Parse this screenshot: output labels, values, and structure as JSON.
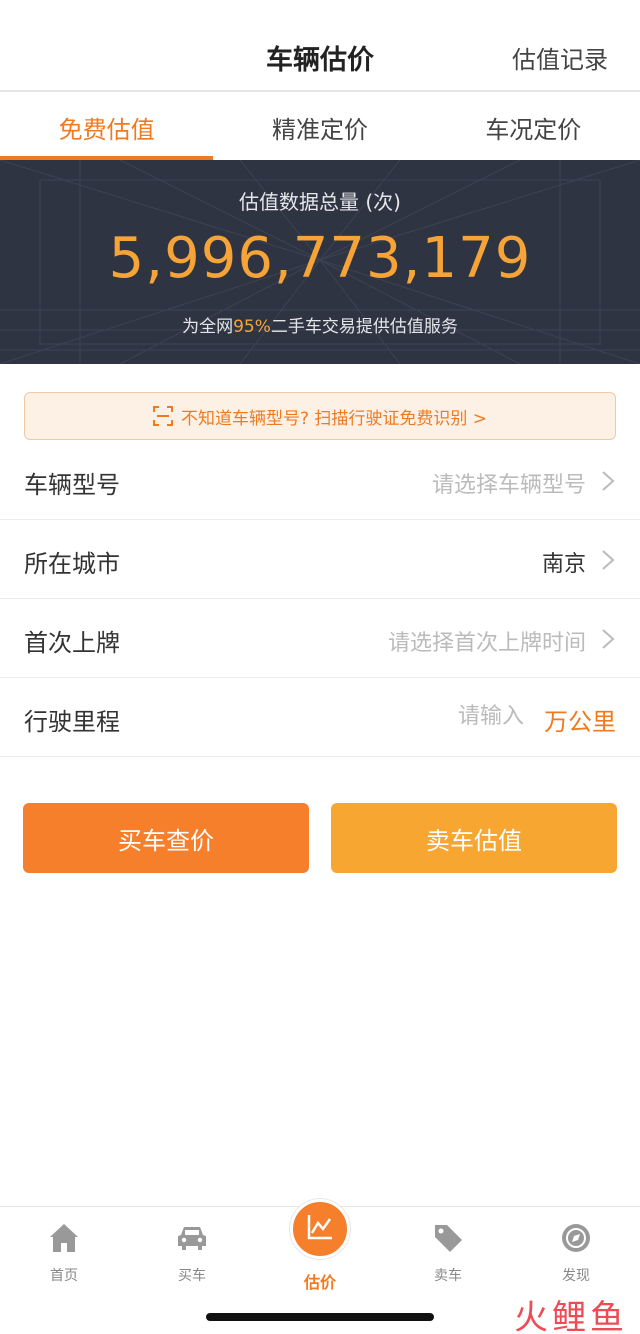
{
  "header": {
    "title": "车辆估价",
    "record_link": "估值记录"
  },
  "tabs": [
    {
      "label": "免费估值",
      "active": true
    },
    {
      "label": "精准定价",
      "active": false
    },
    {
      "label": "车况定价",
      "active": false
    }
  ],
  "banner": {
    "label": "估值数据总量 (次)",
    "count": "5,996,773,179",
    "desc_prefix": "为全网",
    "desc_pct": "95%",
    "desc_suffix": "二手车交易提供估值服务"
  },
  "scan_tip": "不知道车辆型号? 扫描行驶证免费识别 >",
  "form": {
    "model": {
      "label": "车辆型号",
      "placeholder": "请选择车辆型号"
    },
    "city": {
      "label": "所在城市",
      "value": "南京"
    },
    "first_reg": {
      "label": "首次上牌",
      "placeholder": "请选择首次上牌时间"
    },
    "mileage": {
      "label": "行驶里程",
      "placeholder": "请输入",
      "unit": "万公里"
    }
  },
  "buttons": {
    "buy": "买车查价",
    "sell": "卖车估值"
  },
  "nav": [
    {
      "label": "首页",
      "icon": "home-icon"
    },
    {
      "label": "买车",
      "icon": "car-icon"
    },
    {
      "label": "估价",
      "icon": "chart-icon",
      "active": true
    },
    {
      "label": "卖车",
      "icon": "tag-icon"
    },
    {
      "label": "发现",
      "icon": "compass-icon"
    }
  ],
  "watermark": "火鲤鱼",
  "colors": {
    "accent": "#f07a20",
    "buy_button": "#f57f2a",
    "sell_button": "#f7a632",
    "banner_bg": "#2f3443",
    "count_color": "#f6a437"
  }
}
